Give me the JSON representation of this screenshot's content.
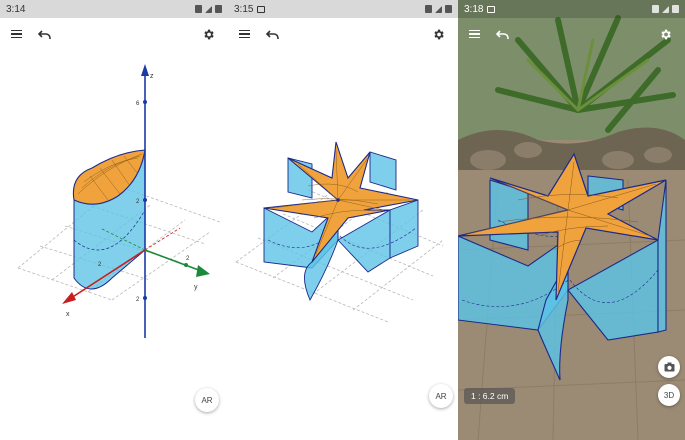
{
  "screens": [
    {
      "status_time": "3:14",
      "ar_label": "AR",
      "axes": {
        "x": "x",
        "y": "y",
        "z": "z"
      },
      "ticks": {
        "z_top": "6",
        "z_mid": "2",
        "x_tick": "2",
        "y_tick": "2",
        "z_neg": "2"
      }
    },
    {
      "status_time": "3:15",
      "ar_label": "AR"
    },
    {
      "status_time": "3:18",
      "scale_text": "1 : 6.2 cm",
      "three_d_label": "3D"
    }
  ],
  "icons": {
    "menu": "menu-icon",
    "undo": "undo-icon",
    "settings": "gear-icon",
    "camera": "camera-icon",
    "alarm": "alarm-icon",
    "signal": "signal-icon",
    "battery": "battery-icon",
    "image": "image-icon"
  },
  "colors": {
    "surface_orange": "#f0a23c",
    "wall_cyan": "#5cc3e6",
    "edge_navy": "#1c2a8a",
    "axis_z": "#1a3aa8",
    "axis_y": "#1a8a3a",
    "axis_x": "#c81e1e"
  }
}
